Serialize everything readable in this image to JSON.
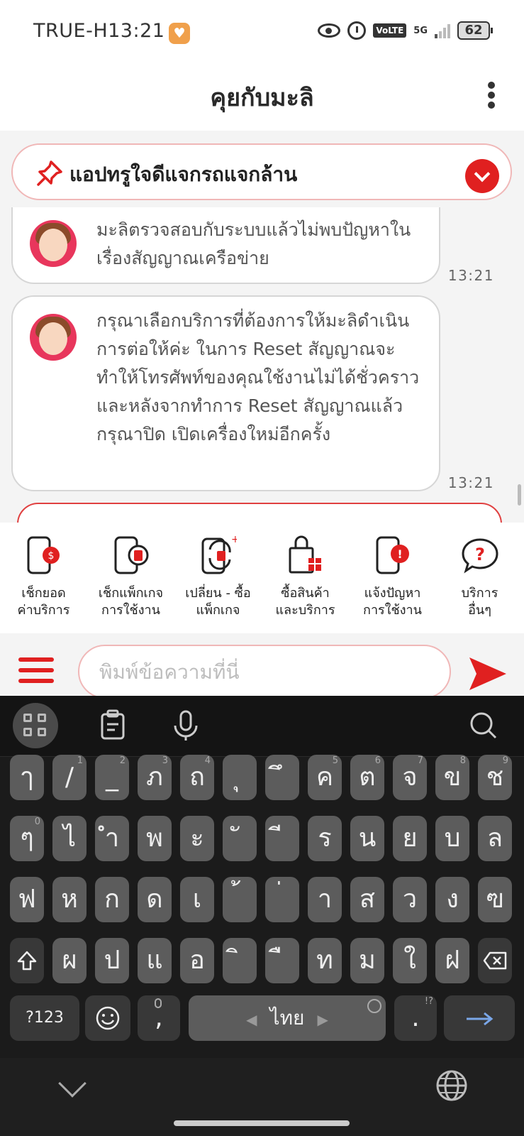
{
  "status_bar": {
    "carrier": "TRUE-H",
    "time": "13:21",
    "network": "5G",
    "volte": "VoLTE",
    "battery": "62"
  },
  "header": {
    "title": "คุยกับมะลิ"
  },
  "pinned": {
    "label": "แอปทรูใจดีแจกรถแจกล้าน"
  },
  "messages": [
    {
      "text": "มะลิตรวจสอบกับระบบแล้วไม่พบปัญหาในเรื่องสัญญาณเครือข่าย",
      "time": "13:21"
    },
    {
      "text": "กรุณาเลือกบริการที่ต้องการให้มะลิดำเนินการต่อให้ค่ะ ในการ Reset สัญญาณจะทำให้โทรศัพท์ของคุณใช้งานไม่ได้ชั่วคราว และหลังจากทำการ Reset สัญญาณแล้ว กรุณาปิด เปิดเครื่องใหม่อีกครั้ง",
      "time": "13:21"
    }
  ],
  "quick_menu": [
    {
      "line1": "เช็กยอด",
      "line2": "ค่าบริการ",
      "icon": "bill-phone-icon"
    },
    {
      "line1": "เช็กแพ็กเกจ",
      "line2": "การใช้งาน",
      "icon": "sim-phone-icon"
    },
    {
      "line1": "เปลี่ยน - ซื้อ",
      "line2": "แพ็กเกจ",
      "icon": "swap-sim-icon"
    },
    {
      "line1": "ซื้อสินค้า",
      "line2": "และบริการ",
      "icon": "shopping-gift-icon"
    },
    {
      "line1": "แจ้งปัญหา",
      "line2": "การใช้งาน",
      "icon": "alert-phone-icon"
    },
    {
      "line1": "บริการ",
      "line2": "อื่นๆ",
      "icon": "question-bubble-icon"
    }
  ],
  "composer": {
    "placeholder": "พิมพ์ข้อความที่นี่"
  },
  "keyboard": {
    "row1": [
      {
        "k": "ๅ",
        "s": ""
      },
      {
        "k": "/",
        "s": "1"
      },
      {
        "k": "_",
        "s": "2"
      },
      {
        "k": "ภ",
        "s": "3"
      },
      {
        "k": "ถ",
        "s": "4"
      },
      {
        "k": "ุ",
        "s": ""
      },
      {
        "k": "ึ",
        "s": ""
      },
      {
        "k": "ค",
        "s": "5"
      },
      {
        "k": "ต",
        "s": "6"
      },
      {
        "k": "จ",
        "s": "7"
      },
      {
        "k": "ข",
        "s": "8"
      },
      {
        "k": "ช",
        "s": "9"
      }
    ],
    "row2": [
      {
        "k": "ๆ",
        "s": "0"
      },
      {
        "k": "ไ",
        "s": ""
      },
      {
        "k": "ำ",
        "s": ""
      },
      {
        "k": "พ",
        "s": ""
      },
      {
        "k": "ะ",
        "s": ""
      },
      {
        "k": "ั",
        "s": ""
      },
      {
        "k": "ี",
        "s": ""
      },
      {
        "k": "ร",
        "s": ""
      },
      {
        "k": "น",
        "s": ""
      },
      {
        "k": "ย",
        "s": ""
      },
      {
        "k": "บ",
        "s": ""
      },
      {
        "k": "ล",
        "s": ""
      }
    ],
    "row3": [
      {
        "k": "ฟ",
        "s": ""
      },
      {
        "k": "ห",
        "s": ""
      },
      {
        "k": "ก",
        "s": ""
      },
      {
        "k": "ด",
        "s": ""
      },
      {
        "k": "เ",
        "s": ""
      },
      {
        "k": "้",
        "s": ""
      },
      {
        "k": "่",
        "s": ""
      },
      {
        "k": "า",
        "s": ""
      },
      {
        "k": "ส",
        "s": ""
      },
      {
        "k": "ว",
        "s": ""
      },
      {
        "k": "ง",
        "s": ""
      },
      {
        "k": "ฃ",
        "s": ""
      }
    ],
    "row4": [
      "ผ",
      "ป",
      "แ",
      "อ",
      "ิ",
      "ื",
      "ท",
      "ม",
      "ใ",
      "ฝ"
    ],
    "symbols_label": "?123",
    "comma": ",",
    "space_label": "ไทย",
    "period": ".",
    "period_hint": "!?"
  }
}
